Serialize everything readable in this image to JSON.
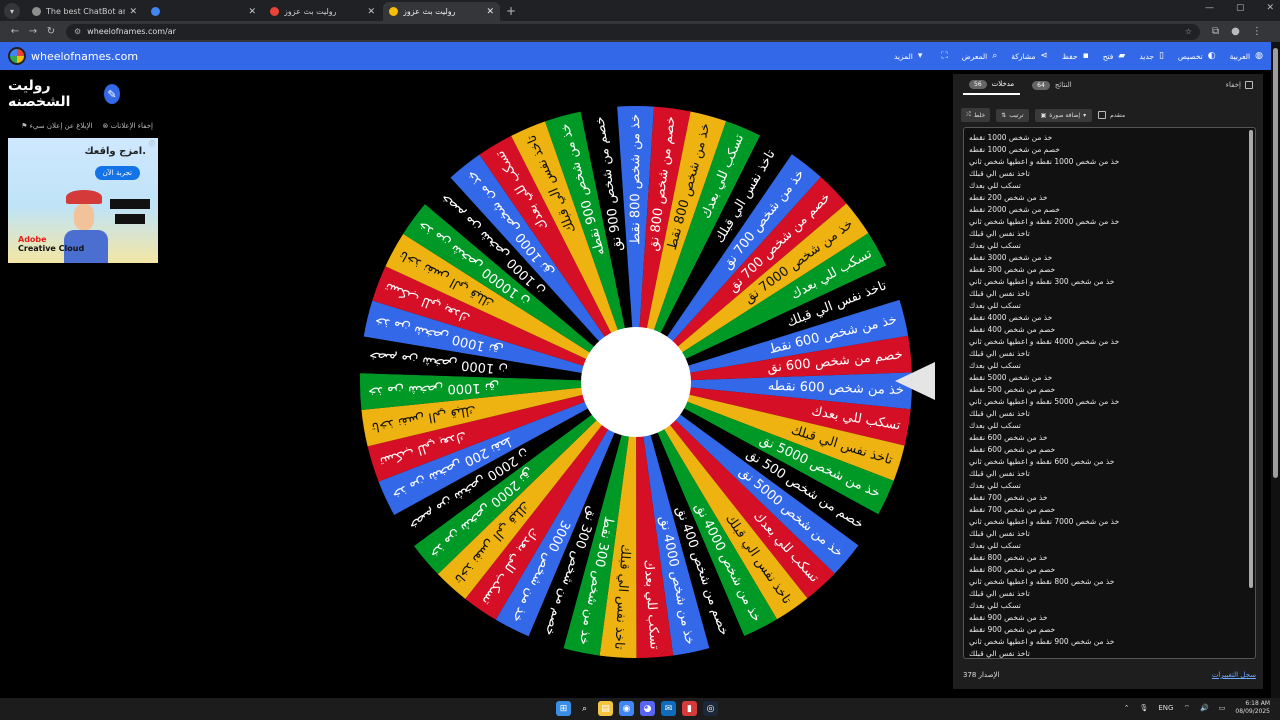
{
  "browser": {
    "tabs": [
      {
        "title": "The best ChatBot and Widgets",
        "active": false,
        "fav": "#8e8e8e"
      },
      {
        "title": "",
        "active": false,
        "fav": "#4285f4"
      },
      {
        "title": "روليت بث عزوز",
        "active": false,
        "fav": "#ea4335"
      },
      {
        "title": "روليت بث عزوز",
        "active": true,
        "fav": "#fbbc05"
      }
    ],
    "url": "wheelofnames.com/ar"
  },
  "app": {
    "brand": "wheelofnames.com",
    "menu": [
      {
        "label": "المزيد",
        "icon": "menu-icon"
      },
      {
        "label": "",
        "icon": "fullscreen-icon"
      },
      {
        "label": "المعرض",
        "icon": "search-icon"
      },
      {
        "label": "مشاركة",
        "icon": "share-icon"
      },
      {
        "label": "حفظ",
        "icon": "save-icon"
      },
      {
        "label": "فتح",
        "icon": "folder-icon"
      },
      {
        "label": "جديد",
        "icon": "file-icon"
      },
      {
        "label": "تخصيص",
        "icon": "palette-icon"
      },
      {
        "label": "العربية",
        "icon": "globe-icon"
      }
    ]
  },
  "page": {
    "title": "روليت الشخصنه",
    "ad_links": {
      "hide_ads": "إخفاء الإعلانات",
      "report_ad": "الإبلاغ عن إعلان سيء"
    }
  },
  "ad": {
    "headline": "امزج واقعك.",
    "cta": "تجربة الآن",
    "brand_line1": "Adobe",
    "brand_line2": "Creative Cloud"
  },
  "panel": {
    "tabs": [
      {
        "label": "مدخلات",
        "count": "56",
        "active": true
      },
      {
        "label": "النتائج",
        "count": "64",
        "active": false
      }
    ],
    "hide_label": "إخفاء",
    "controls": {
      "shuffle": "خلط",
      "sort": "ترتيب",
      "add_image": "إضافة صورة",
      "advanced": "متقدم"
    },
    "entries": [
      "خذ من شخص 1000 نقطه",
      "خصم من شخص 1000 نقطه",
      "خذ من شخص 1000 نقطه و اعطيها شخص ثاني",
      "تاخذ نفس الي قبلك",
      "تسكب للي بعدك",
      "خذ من شخص 200 نقطه",
      "خصم من شخص 2000 نقطه",
      "خذ من شخص 2000 نقطه و اعطيها شخص ثاني",
      "تاخذ نفس الي قبلك",
      "تسكب للي بعدك",
      "خذ من شخص 3000 نقطه",
      "خصم من شخص 300 نقطه",
      "خذ من شخص 300 نقطه و اعطيها شخص ثاني",
      "تاخذ نفس الي قبلك",
      "تسكب للي بعدك",
      "خذ من شخص 4000 نقطه",
      "خصم من شخص 400 نقطه",
      "خذ من شخص 4000 نقطه و اعطيها شخص ثاني",
      "تاخذ نفس الي قبلك",
      "تسكب للي بعدك",
      "خذ من شخص 5000 نقطه",
      "خصم من شخص 500 نقطه",
      "خذ من شخص 5000 نقطه و اعطيها شخص ثاني",
      "تاخذ نفس الي قبلك",
      "تسكب للي بعدك",
      "خذ من شخص 600 نقطه",
      "خصم من شخص 600 نقطه",
      "خذ من شخص 600 نقطه و اعطيها شخص ثاني",
      "تاخذ نفس الي قبلك",
      "تسكب للي بعدك",
      "خذ من شخص 700 نقطه",
      "خصم من شخص 700 نقطه",
      "خذ من شخص 7000 نقطه و اعطيها شخص ثاني",
      "تاخذ نفس الي قبلك",
      "تسكب للي بعدك",
      "خذ من شخص 800 نقطه",
      "خصم من شخص 800 نقطه",
      "خذ من شخص 800 نقطه و اعطيها شخص ثاني",
      "تاخذ نفس الي قبلك",
      "تسكب للي بعدك",
      "خذ من شخص 900 نقطه",
      "خصم من شخص 900 نقطه",
      "خذ من شخص 900 نقطه و اعطيها شخص ثاني",
      "تاخذ نفس الي قبلك"
    ],
    "version_label": "الإصدار",
    "version": "378",
    "changelog": "سجل التغييرات"
  },
  "wheel": {
    "colors": [
      "#3369e8",
      "#d50f25",
      "#eeb211",
      "#009925",
      "#000000"
    ],
    "labels": [
      "خذ من شخص 600 نقطه",
      "تسكب للي بعدك",
      "تاخذ نفس الي قبلك",
      "خذ من شخص 5000 نق",
      "خصم من شخص 500 نق",
      "خذ من شخص 5000 نق",
      "تسكب للي بعدك",
      "تاخذ نفس الي قبلك",
      "خذ من شخص 4000 نق",
      "خصم من شخص 400 نق",
      "خذ من شخص 4000 نق",
      "تسكب للي بعدك",
      "تاخذ نفس الي قبلك",
      "خذ من شخص 300 نقط",
      "خصم من شخص 300 نق",
      "خذ من شخص 3000",
      "تسكب للي بعدك",
      "تاخذ نفس الي قبلك",
      "خذ من شخص 2000 نق",
      "خصم من شخص 2000 ن",
      "خذ من شخص 200 نقط",
      "تسكب للي بعدك",
      "تاخذ نفس الي قبلك",
      "خذ من شخص 1000 نق",
      "خصم من شخص 1000 ن",
      "خذ من شخص 1000 نق",
      "تسكب للي بعدك",
      "تاخذ نفس الي قبلك",
      "خذ من شخص 10000 ن",
      "خصم من شخص 1000 ن",
      "خذ من شخص 1000 نق",
      "تسكب للي بعدك",
      "تاخذ نفس الي قبلك",
      "خذ من شخص 900 نقطه",
      "خصم من شخص 900 نق",
      "خذ من شخص 800 نقط",
      "خصم من شخص 800 نق",
      "خذ من شخص 800 نقط",
      "تسكب للي بعدك",
      "تاخذ نفس الي قبلك",
      "خذ من شخص 700 نق",
      "خصم من شخص 700 نق",
      "خذ من شخص 7000 نق",
      "تسكب للي بعدك",
      "تاخذ نفس الي قبلك",
      "خذ من شخص 600 نقط",
      "خصم من شخص 600 نق"
    ]
  },
  "taskbar": {
    "apps": [
      {
        "icon": "windows-icon",
        "color": "#3a8ee6",
        "glyph": "⊞"
      },
      {
        "icon": "search-icon",
        "color": "#1c1c1c",
        "glyph": "⌕"
      },
      {
        "icon": "file-explorer-icon",
        "color": "#f5c542",
        "glyph": "▤"
      },
      {
        "icon": "chrome-icon",
        "color": "#4285f4",
        "glyph": "◉"
      },
      {
        "icon": "discord-icon",
        "color": "#5865f2",
        "glyph": "◕"
      },
      {
        "icon": "outlook-icon",
        "color": "#0f6cbd",
        "glyph": "✉"
      },
      {
        "icon": "app-icon",
        "color": "#d63b3b",
        "glyph": "▮"
      },
      {
        "icon": "steam-icon",
        "color": "#1b2838",
        "glyph": "◎"
      }
    ],
    "lang": "ENG",
    "time": "6:18 AM",
    "date": "08/09/2025"
  }
}
